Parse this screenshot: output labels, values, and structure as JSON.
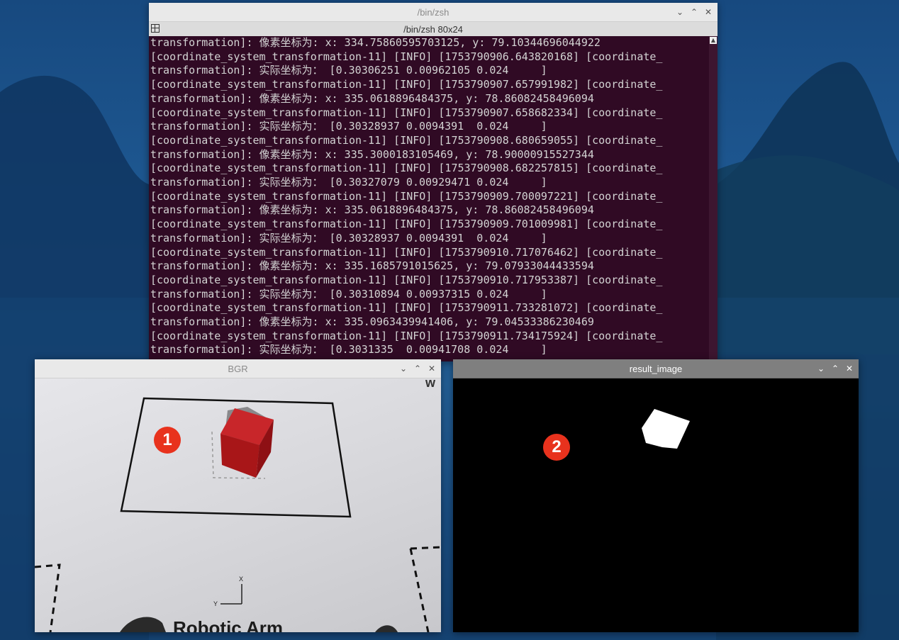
{
  "terminal": {
    "title": "/bin/zsh",
    "subtitle": "/bin/zsh 80x24",
    "lines": [
      "transformation]: 像素坐标为: x: 334.75860595703125, y: 79.10344696044922",
      "[coordinate_system_transformation-11] [INFO] [1753790906.643820168] [coordinate_",
      "transformation]: 实际坐标为： [0.30306251 0.00962105 0.024     ]",
      "[coordinate_system_transformation-11] [INFO] [1753790907.657991982] [coordinate_",
      "transformation]: 像素坐标为: x: 335.0618896484375, y: 78.86082458496094",
      "[coordinate_system_transformation-11] [INFO] [1753790907.658682334] [coordinate_",
      "transformation]: 实际坐标为： [0.30328937 0.0094391  0.024     ]",
      "[coordinate_system_transformation-11] [INFO] [1753790908.680659055] [coordinate_",
      "transformation]: 像素坐标为: x: 335.3000183105469, y: 78.90000915527344",
      "[coordinate_system_transformation-11] [INFO] [1753790908.682257815] [coordinate_",
      "transformation]: 实际坐标为： [0.30327079 0.00929471 0.024     ]",
      "[coordinate_system_transformation-11] [INFO] [1753790909.700097221] [coordinate_",
      "transformation]: 像素坐标为: x: 335.0618896484375, y: 78.86082458496094",
      "[coordinate_system_transformation-11] [INFO] [1753790909.701009981] [coordinate_",
      "transformation]: 实际坐标为： [0.30328937 0.0094391  0.024     ]",
      "[coordinate_system_transformation-11] [INFO] [1753790910.717076462] [coordinate_",
      "transformation]: 像素坐标为: x: 335.1685791015625, y: 79.07933044433594",
      "[coordinate_system_transformation-11] [INFO] [1753790910.717953387] [coordinate_",
      "transformation]: 实际坐标为： [0.30310894 0.00937315 0.024     ]",
      "[coordinate_system_transformation-11] [INFO] [1753790911.733281072] [coordinate_",
      "transformation]: 像素坐标为: x: 335.0963439941406, y: 79.04533386230469",
      "[coordinate_system_transformation-11] [INFO] [1753790911.734175924] [coordinate_",
      "transformation]: 实际坐标为： [0.3031335  0.00941708 0.024     ]"
    ]
  },
  "bgr_window": {
    "title": "BGR",
    "badge": "1",
    "paper_text": "Robotic Arm",
    "corner_text": "w",
    "axis_x": "X",
    "axis_y": "Y"
  },
  "result_window": {
    "title": "result_image",
    "badge": "2"
  },
  "window_controls": {
    "minimize": "⌄",
    "maximize": "⌃",
    "close": "✕"
  },
  "colors": {
    "terminal_bg": "#300a24",
    "badge": "#e8321d",
    "cube": "#b8161a"
  }
}
